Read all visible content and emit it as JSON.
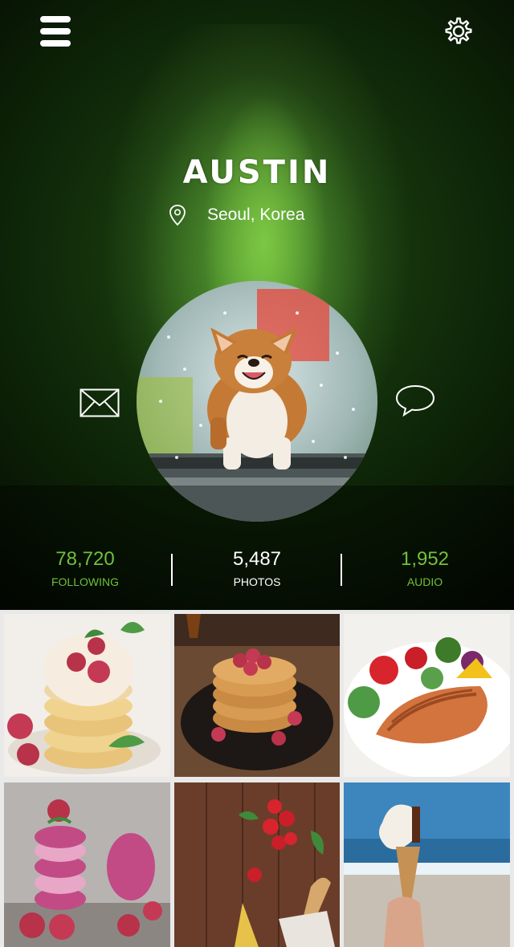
{
  "profile": {
    "name": "AUSTIN",
    "location": "Seoul, Korea"
  },
  "stats": [
    {
      "value": "78,720",
      "label": "FOLLOWING"
    },
    {
      "value": "5,487",
      "label": "PHOTOS"
    },
    {
      "value": "1,952",
      "label": "AUDIO"
    }
  ],
  "colors": {
    "accent_green": "#6fc13a",
    "stat_white": "#ffffff"
  },
  "icons": {
    "menu": "hamburger-menu-icon",
    "settings": "gear-icon",
    "location": "map-pin-icon",
    "mail": "envelope-icon",
    "chat": "speech-bubble-icon"
  },
  "gallery": {
    "tiles": [
      "pancakes-raspberries-mint",
      "pancake-stack-syrup",
      "salmon-salad-plate",
      "raspberry-macarons",
      "tomatoes-pasta-wood",
      "ice-cream-cone-beach"
    ]
  }
}
